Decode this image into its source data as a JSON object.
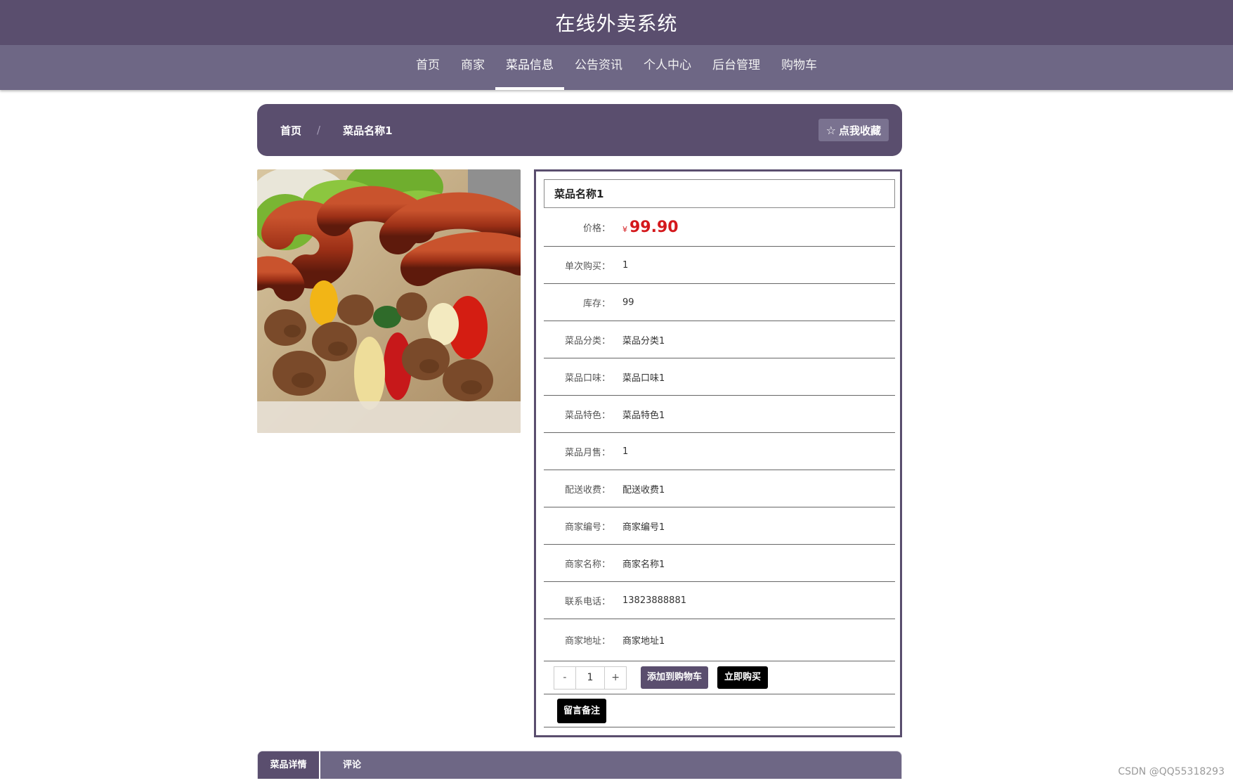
{
  "header": {
    "title": "在线外卖系统"
  },
  "nav": {
    "items": [
      {
        "label": "首页"
      },
      {
        "label": "商家"
      },
      {
        "label": "菜品信息"
      },
      {
        "label": "公告资讯"
      },
      {
        "label": "个人中心"
      },
      {
        "label": "后台管理"
      },
      {
        "label": "购物车"
      }
    ],
    "active_index": 2
  },
  "breadcrumb": {
    "home": "首页",
    "separator": "/",
    "current": "菜品名称1"
  },
  "favorite_button": {
    "icon": "star-outline-icon",
    "label": "点我收藏"
  },
  "product": {
    "image_alt": "grilled sausages and kebabs",
    "name": "菜品名称1",
    "price_currency": "¥",
    "price": "99.90",
    "fields": [
      {
        "label": "价格："
      },
      {
        "label": "单次购买：",
        "value": "1"
      },
      {
        "label": "库存：",
        "value": "99"
      },
      {
        "label": "菜品分类：",
        "value": "菜品分类1"
      },
      {
        "label": "菜品口味：",
        "value": "菜品口味1"
      },
      {
        "label": "菜品特色：",
        "value": "菜品特色1"
      },
      {
        "label": "菜品月售：",
        "value": "1"
      },
      {
        "label": "配送收费：",
        "value": "配送收费1"
      },
      {
        "label": "商家编号：",
        "value": "商家编号1"
      },
      {
        "label": "商家名称：",
        "value": "商家名称1"
      },
      {
        "label": "联系电话：",
        "value": "13823888881"
      },
      {
        "label": "商家地址：",
        "value": "商家地址1"
      }
    ]
  },
  "actions": {
    "minus": "-",
    "quantity": "1",
    "plus": "+",
    "add_to_cart": "添加到购物车",
    "buy_now": "立即购买",
    "leave_note": "留言备注"
  },
  "tabs": [
    {
      "label": "菜品详情"
    },
    {
      "label": "评论"
    }
  ],
  "watermark": "CSDN @QQ55318293",
  "colors": {
    "primary": "#5a4e6e",
    "nav": "#6e6785",
    "price": "#d4181c"
  }
}
